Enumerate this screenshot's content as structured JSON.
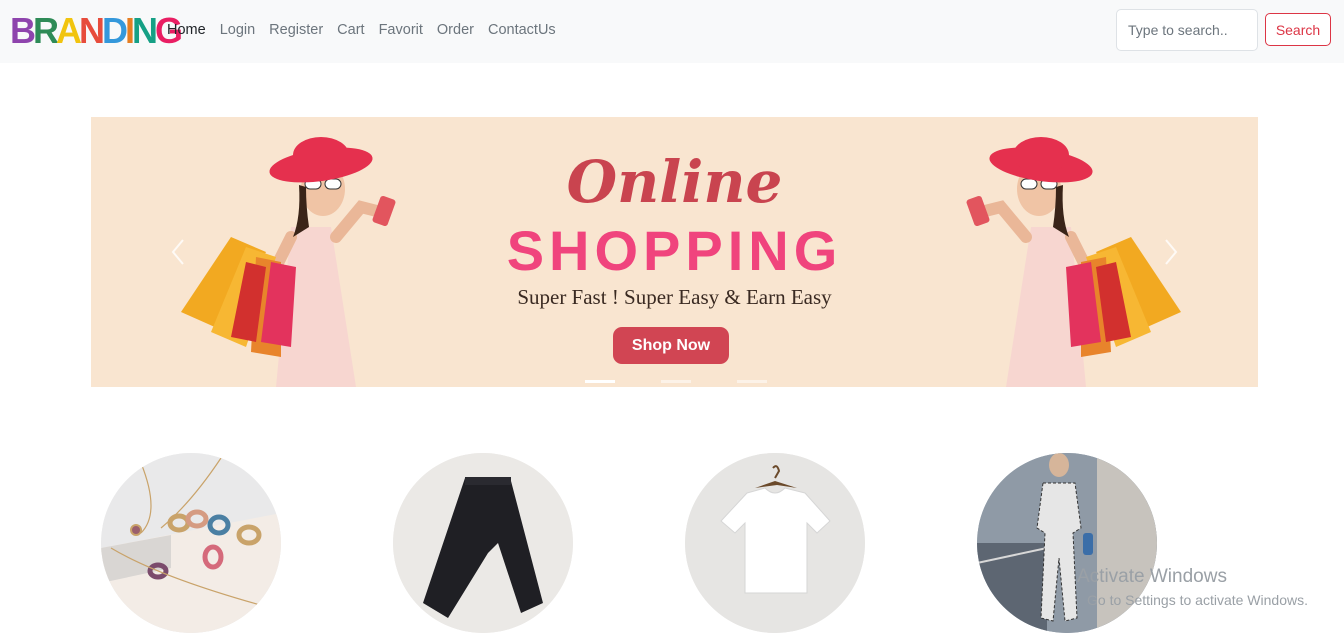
{
  "brand": {
    "letters": [
      {
        "ch": "B",
        "color": "#8e44ad"
      },
      {
        "ch": "R",
        "color": "#2e8b57"
      },
      {
        "ch": "A",
        "color": "#f1c40f"
      },
      {
        "ch": "N",
        "color": "#e74c3c"
      },
      {
        "ch": "D",
        "color": "#3498db"
      },
      {
        "ch": "I",
        "color": "#e67e22"
      },
      {
        "ch": "N",
        "color": "#16a085"
      },
      {
        "ch": "G",
        "color": "#e91e63"
      }
    ]
  },
  "nav": {
    "links": [
      {
        "label": "Home",
        "active": true
      },
      {
        "label": "Login",
        "active": false
      },
      {
        "label": "Register",
        "active": false
      },
      {
        "label": "Cart",
        "active": false
      },
      {
        "label": "Favorit",
        "active": false
      },
      {
        "label": "Order",
        "active": false
      },
      {
        "label": "ContactUs",
        "active": false
      }
    ]
  },
  "search": {
    "placeholder": "Type to search..",
    "button_label": "Search"
  },
  "banner": {
    "script_title": "Online",
    "big_title": "SHOPPING",
    "tagline": "Super Fast ! Super Easy & Earn Easy",
    "button_label": "Shop Now",
    "active_slide": 1,
    "slide_count": 3
  },
  "categories": [
    {
      "name": "jewelry"
    },
    {
      "name": "pants"
    },
    {
      "name": "t-shirt"
    },
    {
      "name": "fashion"
    }
  ],
  "watermark": {
    "line1": "Activate Windows",
    "line2": "Go to Settings to activate Windows."
  },
  "colors": {
    "accent": "#dc3545",
    "banner_bg": "#f9e5d0",
    "banner_pink": "#f0447d",
    "banner_red": "#c9444f"
  }
}
